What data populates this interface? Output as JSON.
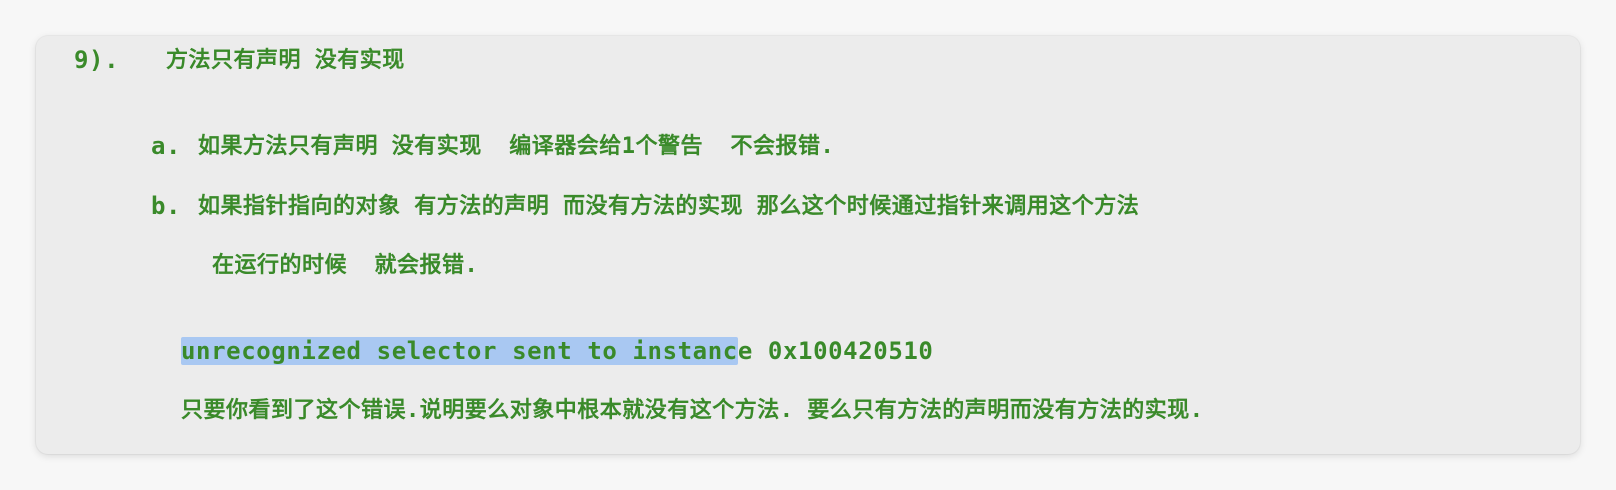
{
  "heading": {
    "number": "9).",
    "title": "方法只有声明 没有实现"
  },
  "items": [
    {
      "label": "a.",
      "text": "如果方法只有声明 没有实现  编译器会给1个警告  不会报错."
    },
    {
      "label": "b.",
      "text": "如果指针指向的对象 有方法的声明 而没有方法的实现 那么这个时候通过指针来调用这个方法"
    }
  ],
  "continuation": "在运行的时候  就会报错.",
  "error": {
    "highlighted": "unrecognized selector sent to instanc",
    "rest": "e 0x100420510"
  },
  "explanation": "只要你看到了这个错误.说明要么对象中根本就没有这个方法. 要么只有方法的声明而没有方法的实现.",
  "colors": {
    "text": "#3a8a2a",
    "highlight": "#a9c8f2",
    "background": "#ececec"
  }
}
